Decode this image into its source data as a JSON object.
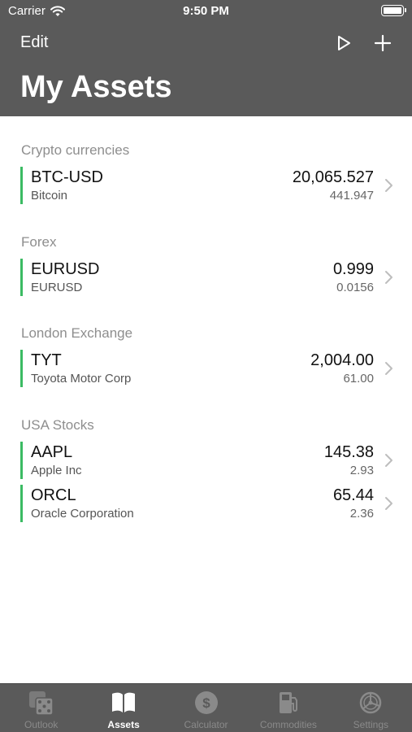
{
  "status_bar": {
    "carrier": "Carrier",
    "time": "9:50 PM"
  },
  "nav": {
    "edit_label": "Edit",
    "title": "My Assets"
  },
  "sections": [
    {
      "title": "Crypto currencies",
      "rows": [
        {
          "symbol": "BTC-USD",
          "name": "Bitcoin",
          "price": "20,065.527",
          "change": "441.947"
        }
      ]
    },
    {
      "title": "Forex",
      "rows": [
        {
          "symbol": "EURUSD",
          "name": "EURUSD",
          "price": "0.999",
          "change": "0.0156"
        }
      ]
    },
    {
      "title": "London Exchange",
      "rows": [
        {
          "symbol": "TYT",
          "name": "Toyota Motor Corp",
          "price": "2,004.00",
          "change": "61.00"
        }
      ]
    },
    {
      "title": "USA Stocks",
      "rows": [
        {
          "symbol": "AAPL",
          "name": "Apple Inc",
          "price": "145.38",
          "change": "2.93"
        },
        {
          "symbol": "ORCL",
          "name": "Oracle Corporation",
          "price": "65.44",
          "change": "2.36"
        }
      ]
    }
  ],
  "tabs": [
    {
      "label": "Outlook",
      "icon": "dice-icon",
      "active": false
    },
    {
      "label": "Assets",
      "icon": "book-icon",
      "active": true
    },
    {
      "label": "Calculator",
      "icon": "dollar-coin-icon",
      "active": false
    },
    {
      "label": "Commodities",
      "icon": "fuel-pump-icon",
      "active": false
    },
    {
      "label": "Settings",
      "icon": "gear-icon",
      "active": false
    }
  ],
  "colors": {
    "header_bg": "#5a5a5a",
    "accent_green": "#3bbb63",
    "section_text": "#8e8e8e"
  }
}
